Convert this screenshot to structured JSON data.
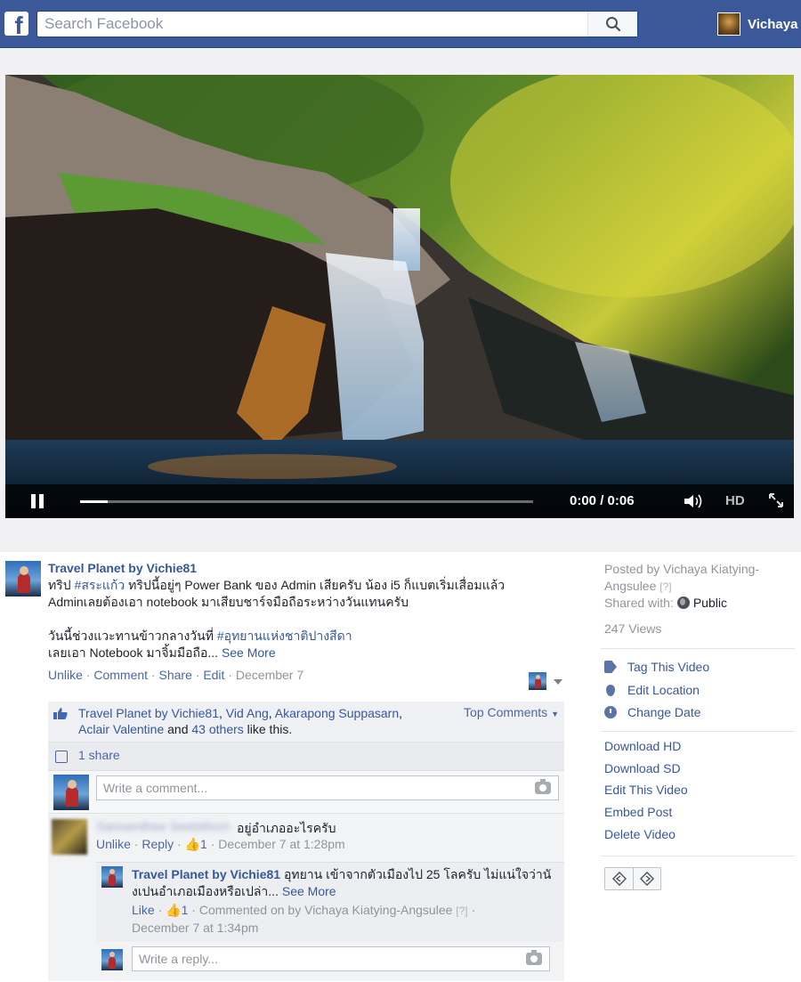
{
  "topbar": {
    "logo_letter": "f",
    "search_placeholder": "Search Facebook",
    "user_name": "Vichaya"
  },
  "video": {
    "time": "0:00 / 0:06",
    "progress": 0.06,
    "hd_label": "HD",
    "volume_icon": "speaker-icon",
    "fullscreen_icon": "expand-icon"
  },
  "post": {
    "author": "Travel Planet by Vichie81",
    "line1_prefix": "ทริป ",
    "line1_hashtag": "#สระแก้ว",
    "line1_rest": " ทริปนี้อยู่ๆ Power Bank ของ Admin เสียครับ น้อง i5 ก็แบตเริ่มเสื่อมแล้ว",
    "line2": "Adminเลยต้องเอา notebook มาเสียบชาร์จมือถือระหว่างวันแทนครับ",
    "line3_prefix": "วันนี้ช่วงแวะทานข้าวกลางวันที่ ",
    "line3_hashtag": "#อุทยานแห่งชาติปางสีดา",
    "line4": "เลยเอา Notebook มาจิ้มมือถือ... ",
    "see_more": "See More",
    "actions": {
      "unlike": "Unlike",
      "comment": "Comment",
      "share": "Share",
      "edit": "Edit",
      "date": "December 7",
      "dot": " · "
    },
    "likes": {
      "name1": "Travel Planet by Vichie81",
      "name2": "Vid Ang",
      "name3": "Akarapong Suppasarn",
      "name4": "Aclair Valentine",
      "and": " and ",
      "others": "43 others",
      "like_this": " like this."
    },
    "top_comments": "Top Comments",
    "shares": "1 share",
    "comment_placeholder": "Write a comment...",
    "comment1": {
      "name_blurred": "Samsenthee Seetsthorn",
      "text": "อยู่อำเภออะไรครับ",
      "unlike": "Unlike",
      "reply": "Reply",
      "likes": "1",
      "date": "December 7 at 1:28pm"
    },
    "reply1": {
      "author": "Travel Planet by Vichie81",
      "text": " อุทยาน เข้าจากตัวเมืองไป 25 โลครับ ไม่แน่ใจว่านังเปนอำเภอเมืองหรือเปล่า... ",
      "see_more": "See More",
      "like": "Like",
      "likes": "1",
      "commented_on": "Commented on by Vichaya Kiatying-Angsulee",
      "qmark": "[?]",
      "date": "December 7 at 1:34pm"
    },
    "reply_placeholder": "Write a reply..."
  },
  "side": {
    "posted_by": "Posted by Vichaya Kiatying-Angsulee",
    "qmark": "[?]",
    "shared_with": "Shared with:",
    "audience": "Public",
    "views": "247 Views",
    "tag_video": "Tag This Video",
    "edit_location": "Edit Location",
    "change_date": "Change Date",
    "download_hd": "Download HD",
    "download_sd": "Download SD",
    "edit_video": "Edit This Video",
    "embed_post": "Embed Post",
    "delete_video": "Delete Video"
  }
}
